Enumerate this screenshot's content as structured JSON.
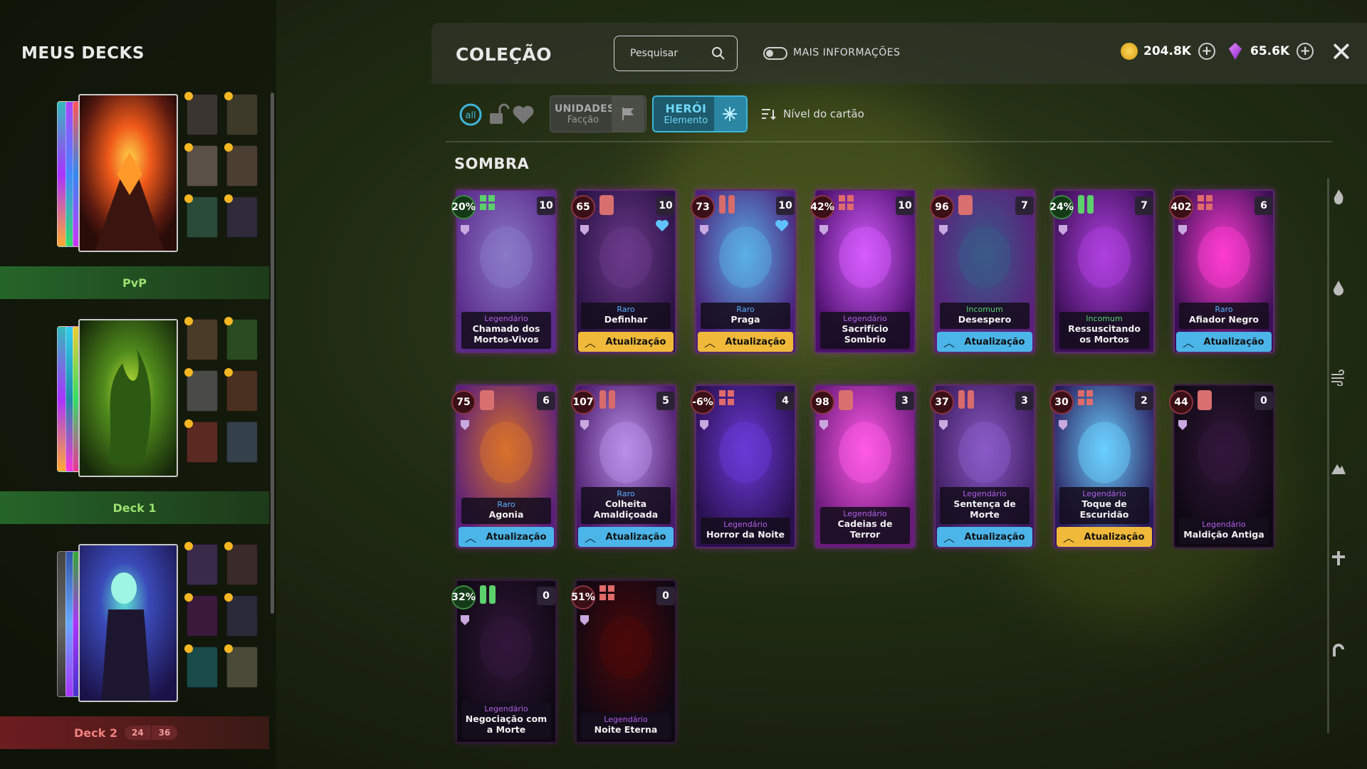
{
  "left_panel": {
    "title": "MEUS DECKS",
    "decks": [
      {
        "label": "PvP",
        "style": "green",
        "counts": null
      },
      {
        "label": "Deck 1",
        "style": "green",
        "counts": null
      },
      {
        "label": "Deck 2",
        "style": "red",
        "counts": [
          "24",
          "36"
        ]
      }
    ]
  },
  "header": {
    "title": "COLEÇÃO",
    "search_placeholder": "Pesquisar",
    "more_info_label": "MAIS INFORMAÇÕES",
    "gold": "204.8K",
    "gems": "65.6K"
  },
  "filters": {
    "units": {
      "title": "UNIDADES",
      "subtitle": "Facção"
    },
    "hero": {
      "title": "HERÓI",
      "subtitle": "Elemento"
    },
    "sort_label": "Nível do cartão"
  },
  "section_title": "SOMBRA",
  "colors": {
    "accent_blue": "#4bb5e9",
    "accent_yellow": "#f0b93a",
    "legendary": "#b15fe6",
    "rare": "#5dafff",
    "uncommon": "#5bd06b"
  },
  "cards": [
    {
      "cost": "20%",
      "level": "10",
      "rarity": "Legendário",
      "rarity_class": "leg",
      "name": "Chamado dos Mortos-Vivos",
      "upgrade": null,
      "cost_style": "green"
    },
    {
      "cost": "65",
      "level": "10",
      "rarity": "Raro",
      "rarity_class": "rare",
      "name": "Definhar",
      "upgrade": "Atualização",
      "upgrade_color": "yellow"
    },
    {
      "cost": "73",
      "level": "10",
      "rarity": "Raro",
      "rarity_class": "rare",
      "name": "Praga",
      "upgrade": "Atualização",
      "upgrade_color": "yellow"
    },
    {
      "cost": "42%",
      "level": "10",
      "rarity": "Legendário",
      "rarity_class": "leg",
      "name": "Sacrifício Sombrio",
      "upgrade": null
    },
    {
      "cost": "96",
      "level": "7",
      "rarity": "Incomum",
      "rarity_class": "unc",
      "name": "Desespero",
      "upgrade": "Atualização",
      "upgrade_color": "blue"
    },
    {
      "cost": "24%",
      "level": "7",
      "rarity": "Incomum",
      "rarity_class": "unc",
      "name": "Ressuscitando os Mortos",
      "upgrade": null,
      "cost_style": "green"
    },
    {
      "cost": "402",
      "level": "6",
      "rarity": "Raro",
      "rarity_class": "rare",
      "name": "Afiador Negro",
      "upgrade": "Atualização",
      "upgrade_color": "blue"
    },
    {
      "cost": "75",
      "level": "6",
      "rarity": "Raro",
      "rarity_class": "rare",
      "name": "Agonia",
      "upgrade": "Atualização",
      "upgrade_color": "blue"
    },
    {
      "cost": "107",
      "level": "5",
      "rarity": "Raro",
      "rarity_class": "rare",
      "name": "Colheita Amaldiçoada",
      "upgrade": "Atualização",
      "upgrade_color": "blue"
    },
    {
      "cost": "-6%",
      "level": "4",
      "rarity": "Legendário",
      "rarity_class": "leg",
      "name": "Horror da Noite",
      "upgrade": null
    },
    {
      "cost": "98",
      "level": "3",
      "rarity": "Legendário",
      "rarity_class": "leg",
      "name": "Cadeias de Terror",
      "upgrade": null
    },
    {
      "cost": "37",
      "level": "3",
      "rarity": "Legendário",
      "rarity_class": "leg",
      "name": "Sentença de Morte",
      "upgrade": "Atualização",
      "upgrade_color": "blue"
    },
    {
      "cost": "30",
      "level": "2",
      "rarity": "Legendário",
      "rarity_class": "leg",
      "name": "Toque de Escuridão",
      "upgrade": "Atualização",
      "upgrade_color": "yellow"
    },
    {
      "cost": "44",
      "level": "0",
      "rarity": "Legendário",
      "rarity_class": "leg",
      "name": "Maldição Antiga",
      "upgrade": null,
      "dim": true
    },
    {
      "cost": "32%",
      "level": "0",
      "rarity": "Legendário",
      "rarity_class": "leg",
      "name": "Negociação com a Morte",
      "upgrade": null,
      "dim": true,
      "cost_style": "green"
    },
    {
      "cost": "51%",
      "level": "0",
      "rarity": "Legendário",
      "rarity_class": "leg",
      "name": "Noite Eterna",
      "upgrade": null,
      "dim": true
    }
  ],
  "right_sidebar_icons": [
    "fire-icon",
    "water-icon",
    "wind-icon",
    "earth-icon",
    "light-icon",
    "shadow-icon"
  ]
}
